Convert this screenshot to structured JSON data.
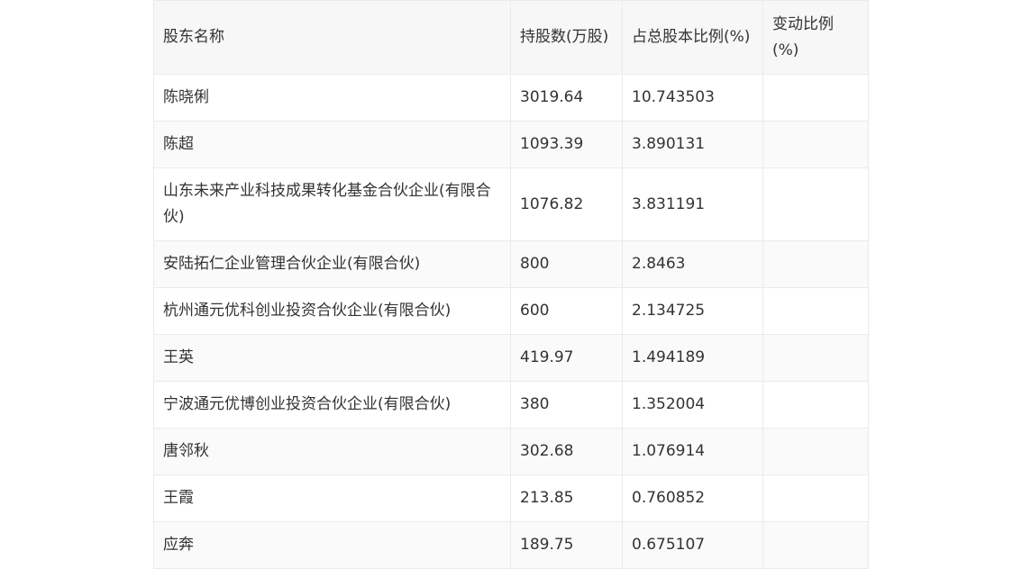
{
  "table": {
    "headers": [
      "股东名称",
      "持股数(万股)",
      "占总股本比例(%)",
      "变动比例(%)"
    ],
    "rows": [
      [
        "陈晓俐",
        "3019.64",
        "10.743503",
        ""
      ],
      [
        "陈超",
        "1093.39",
        "3.890131",
        ""
      ],
      [
        "山东未来产业科技成果转化基金合伙企业(有限合伙)",
        "1076.82",
        "3.831191",
        ""
      ],
      [
        "安陆拓仁企业管理合伙企业(有限合伙)",
        "800",
        "2.8463",
        ""
      ],
      [
        "杭州通元优科创业投资合伙企业(有限合伙)",
        "600",
        "2.134725",
        ""
      ],
      [
        "王英",
        "419.97",
        "1.494189",
        ""
      ],
      [
        "宁波通元优博创业投资合伙企业(有限合伙)",
        "380",
        "1.352004",
        ""
      ],
      [
        "唐邻秋",
        "302.68",
        "1.076914",
        ""
      ],
      [
        "王霞",
        "213.85",
        "0.760852",
        ""
      ],
      [
        "应奔",
        "189.75",
        "0.675107",
        ""
      ]
    ]
  }
}
